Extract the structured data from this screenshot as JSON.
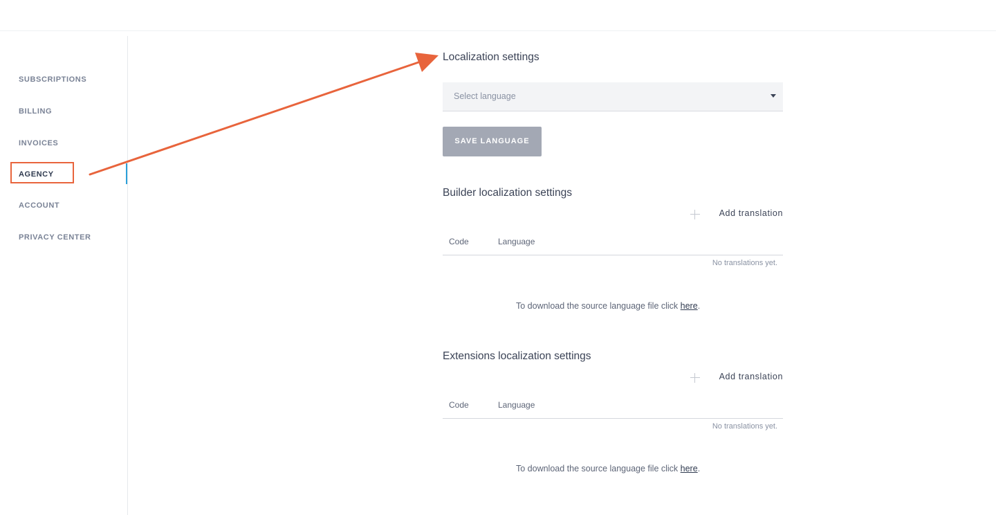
{
  "sidebar": {
    "items": [
      {
        "label": "SUBSCRIPTIONS"
      },
      {
        "label": "BILLING"
      },
      {
        "label": "INVOICES"
      },
      {
        "label": "AGENCY"
      },
      {
        "label": "ACCOUNT"
      },
      {
        "label": "PRIVACY CENTER"
      }
    ],
    "active": "AGENCY"
  },
  "localization": {
    "title": "Localization settings",
    "select_placeholder": "Select language",
    "save_label": "SAVE LANGUAGE"
  },
  "builder": {
    "title": "Builder localization settings",
    "add_label": "Add translation",
    "columns": [
      "Code",
      "Language"
    ],
    "empty_text": "No translations yet.",
    "download_text": "To download the source language file click ",
    "download_link": "here",
    "download_suffix": "."
  },
  "extensions": {
    "title": "Extensions localization settings",
    "add_label": "Add translation",
    "columns": [
      "Code",
      "Language"
    ],
    "empty_text": "No translations yet.",
    "download_text": "To download the source language file click ",
    "download_link": "here",
    "download_suffix": "."
  },
  "colors": {
    "accent": "#2ca0d9",
    "annotation": "#e8643c",
    "button": "#a3a8b4"
  },
  "icons": {
    "select_caret": "chevron-down-icon",
    "add": "plus-icon"
  }
}
